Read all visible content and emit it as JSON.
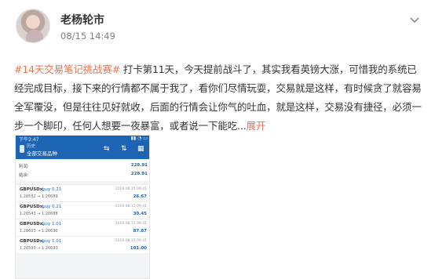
{
  "post": {
    "username": "老杨轮市",
    "timestamp": "08/15 14:49",
    "hashtag": "#14天交易笔记挑战赛#",
    "body": "打卡第11天，今天提前战斗了，其实我看英镑大涨，可惜我的系统已经完成目标，接下来的行情都不属于我了，看你们尽情玩耍，交易就是这样，有时候贪了就容易全军覆没，但是往往见好就收，后面的行情会让你气的吐血，就是这样，交易没有捷径，必须一步一个脚印，任何人想要一夜暴富，或者说一下能吃...",
    "expand_label": "展开"
  },
  "icons": {
    "more": "chevron-down-icon",
    "back": "back-arrow-icon",
    "sort": "sort-icon",
    "swap": "swap-icon",
    "calendar": "calendar-icon"
  },
  "colors": {
    "accent": "#eb7350",
    "app_header": "#1e64b4"
  },
  "screenshot": {
    "status_time": "下午2:47",
    "status_icons": "▮▮ ◔ ▭",
    "nav_subtitle": "历史",
    "nav_title": "全部交易品种",
    "nav_icon_1": "⇆",
    "nav_icon_2": "⇅",
    "nav_icon_3": "▦",
    "summary": [
      {
        "label": "利润:",
        "value": "228.91"
      },
      {
        "label": "结余:",
        "value": "228.91"
      }
    ],
    "trades": [
      {
        "symbol": "GBPUSDx,",
        "side": "buy 0.21",
        "time": "2019.08.15 09:41",
        "prices": "1.20552 → 1.20689",
        "profit": "26.67"
      },
      {
        "symbol": "GBPUSDx,",
        "side": "buy 0.21",
        "time": "2019.08.15 09:41",
        "prices": "1.20543 → 1.20688",
        "profit": "30.45"
      },
      {
        "symbol": "GBPUSDx,",
        "side": "buy 1.01",
        "time": "2019.08.15 09:41",
        "prices": "1.20603 → 1.20690",
        "profit": "87.87"
      },
      {
        "symbol": "GBPUSDx,",
        "side": "buy 1.01",
        "time": "2019.08.15 09:41",
        "prices": "1.20593 → 1.20693",
        "profit": "101.00"
      }
    ]
  }
}
